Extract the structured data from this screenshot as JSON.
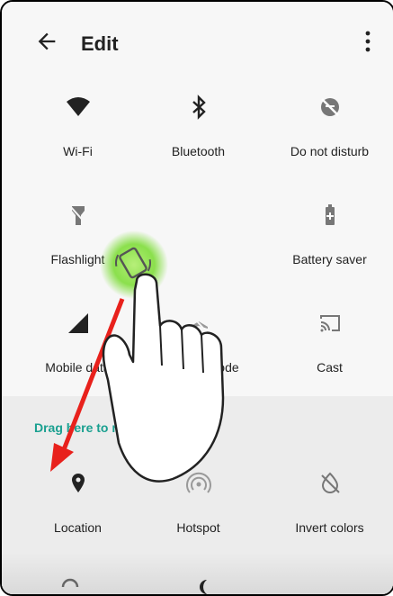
{
  "header": {
    "title": "Edit",
    "back_icon": "arrow-left-icon",
    "menu_icon": "more-vert-icon"
  },
  "active_tiles": [
    {
      "label": "Wi-Fi",
      "icon": "wifi-icon"
    },
    {
      "label": "Bluetooth",
      "icon": "bluetooth-icon"
    },
    {
      "label": "Do not disturb",
      "icon": "do-not-disturb-icon"
    },
    {
      "label": "Flashlight",
      "icon": "flashlight-icon"
    },
    {
      "label": "",
      "icon": "auto-rotate-icon"
    },
    {
      "label": "Battery saver",
      "icon": "battery-saver-icon"
    },
    {
      "label": "Mobile data",
      "icon": "mobile-data-icon"
    },
    {
      "label": "Airplane mode",
      "icon": "airplane-mode-icon"
    },
    {
      "label": "Cast",
      "icon": "cast-icon"
    }
  ],
  "drag_hint": "Drag here to remove",
  "available_tiles": [
    {
      "label": "Location",
      "icon": "location-icon"
    },
    {
      "label": "Hotspot",
      "icon": "hotspot-icon"
    },
    {
      "label": "Invert colors",
      "icon": "invert-colors-icon"
    }
  ],
  "colors": {
    "accent": "#1aa090",
    "arrow": "#e8211c",
    "highlight": "#7fdd3a"
  }
}
